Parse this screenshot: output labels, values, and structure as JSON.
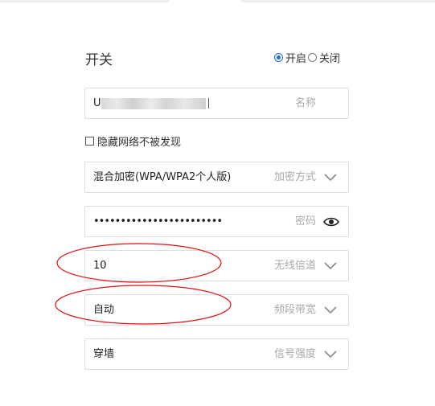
{
  "switch": {
    "title": "开关",
    "options": [
      {
        "label": "开启",
        "selected": true
      },
      {
        "label": "关闭",
        "selected": false
      }
    ]
  },
  "name_field": {
    "value": "U",
    "hint": "名称"
  },
  "hide_network": {
    "label": "隐藏网络不被发现",
    "checked": false
  },
  "encryption": {
    "value": "混合加密(WPA/WPA2个人版)",
    "hint": "加密方式"
  },
  "password": {
    "value": "••••••••••••••••••••••••",
    "hint": "密码"
  },
  "channel": {
    "value": "10",
    "hint": "无线信道"
  },
  "bandwidth": {
    "value": "自动",
    "hint": "频段带宽"
  },
  "signal": {
    "value": "穿墙",
    "hint": "信号强度"
  },
  "colors": {
    "accent": "#1d6fd8",
    "annotation": "#e01010",
    "border": "#dddddd",
    "hint": "#aaaaaa"
  }
}
